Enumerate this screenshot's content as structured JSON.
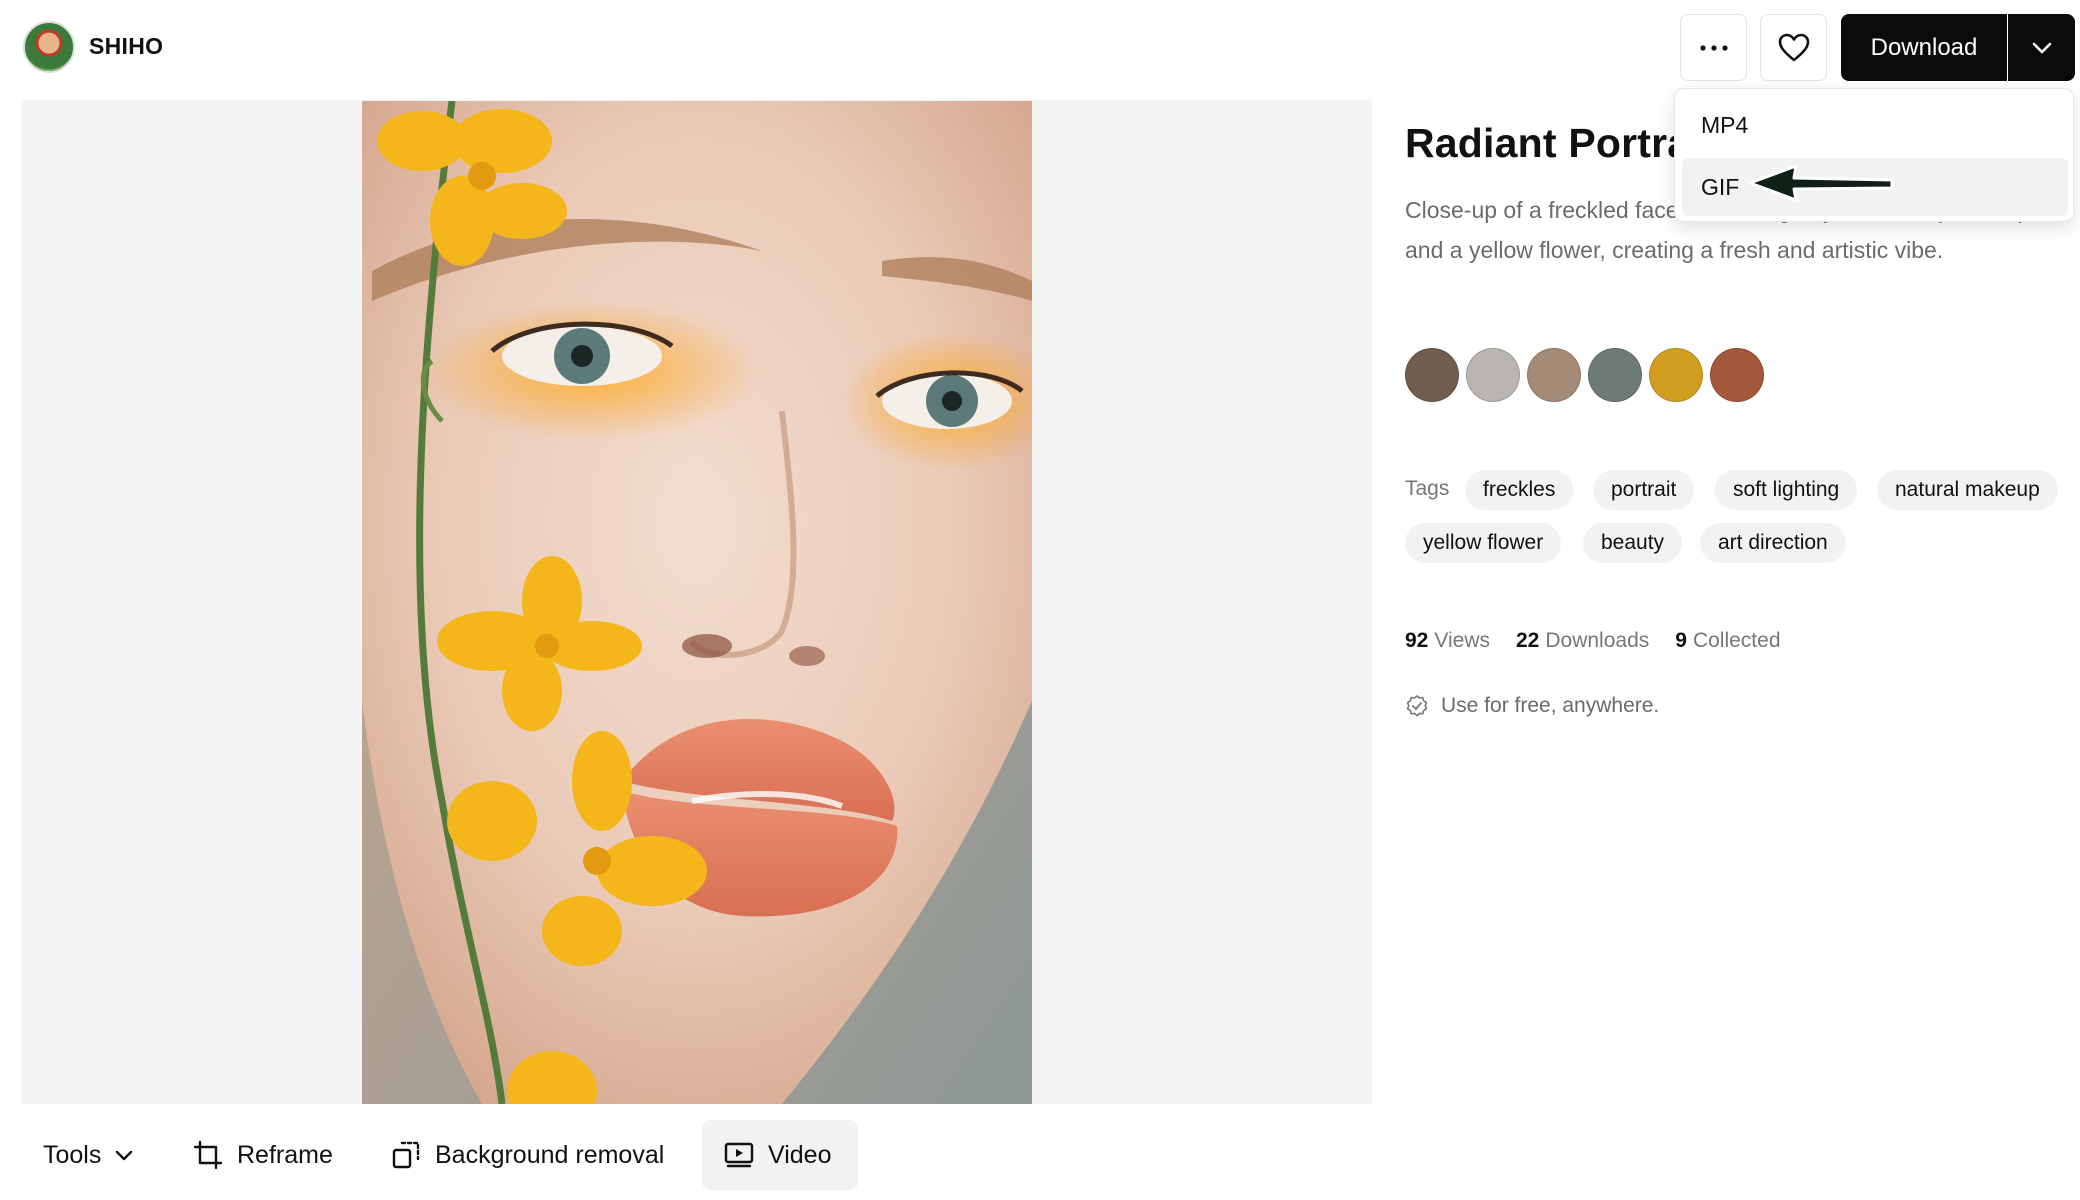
{
  "author": {
    "name": "SHIHO"
  },
  "actions": {
    "download_label": "Download"
  },
  "download_menu": {
    "items": [
      {
        "label": "MP4"
      },
      {
        "label": "GIF"
      }
    ]
  },
  "asset": {
    "title": "Radiant Portrait",
    "description": "Close-up of a freckled face with orange eyeshadow, peach lips, and a yellow flower, creating a fresh and artistic vibe."
  },
  "palette": [
    "#6f5e50",
    "#b9b6b1",
    "#a48b77",
    "#6d7a77",
    "#d19e22",
    "#a3583a"
  ],
  "tags": {
    "label": "Tags",
    "items": [
      "freckles",
      "portrait",
      "soft lighting",
      "natural makeup",
      "yellow flower",
      "beauty",
      "art direction"
    ]
  },
  "stats": {
    "views": {
      "count": "92",
      "label": "Views"
    },
    "downloads": {
      "count": "22",
      "label": "Downloads"
    },
    "collected": {
      "count": "9",
      "label": "Collected"
    }
  },
  "license": {
    "text": "Use for free, anywhere."
  },
  "toolbar": {
    "tools_label": "Tools",
    "reframe_label": "Reframe",
    "bg_removal_label": "Background removal",
    "video_label": "Video"
  }
}
